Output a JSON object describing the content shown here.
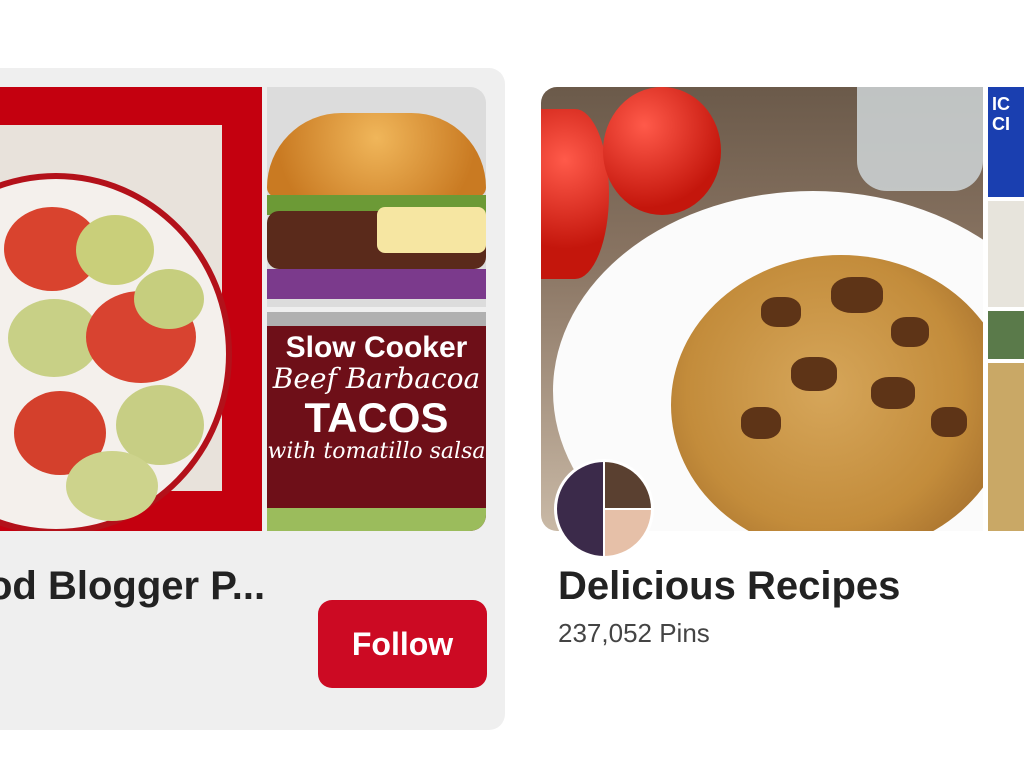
{
  "boards": [
    {
      "title": "od Blogger P...",
      "follow_label": "Follow",
      "thumbnails": {
        "tacos": {
          "line1": "Slow Cooker",
          "line2": "Beef Barbacoa",
          "line3": "TACOS",
          "line4": "with tomatillo salsa"
        }
      }
    },
    {
      "title": "Delicious Recipes",
      "pin_count": "237,052 Pins",
      "thumbnails": {
        "strip_text": "IC\nCI"
      }
    }
  ],
  "colors": {
    "follow_button": "#cc0a23",
    "card_background": "#efefef",
    "title_text": "#222222"
  }
}
